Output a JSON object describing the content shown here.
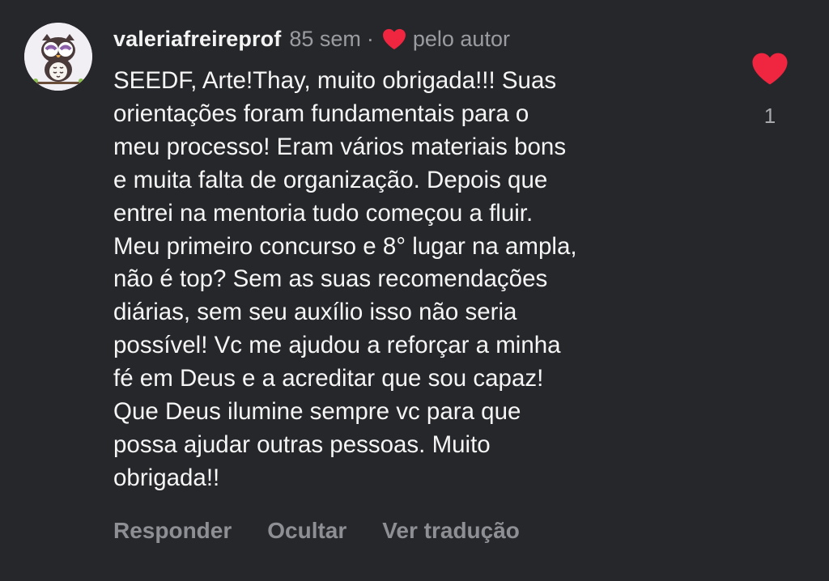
{
  "comment": {
    "username": "valeriafreireprof",
    "time": "85 sem",
    "separator": "·",
    "author_like_label": "pelo autor",
    "text": "SEEDF, Arte!Thay, muito obrigada!!! Suas\norientações foram fundamentais para o\nmeu processo! Eram vários materiais bons\ne muita falta de organização. Depois que\nentrei na mentoria tudo começou a fluir.\nMeu primeiro concurso e 8° lugar na ampla,\nnão é top? Sem as suas recomendações\ndiárias, sem seu auxílio isso não seria\npossível! Vc me ajudou a reforçar a minha\nfé em Deus e  a acreditar que sou capaz!\nQue Deus ilumine sempre vc para que\npossa ajudar outras pessoas. Muito\nobrigada!!",
    "like_count": "1",
    "avatar_icon": "owl-icon",
    "heart_color": "#f0253f"
  },
  "actions": {
    "reply": "Responder",
    "hide": "Ocultar",
    "translate": "Ver tradução"
  }
}
